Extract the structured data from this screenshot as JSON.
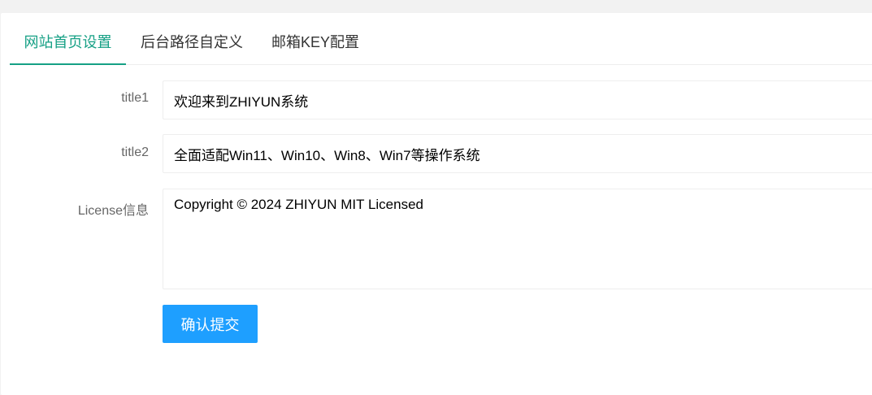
{
  "tabs": [
    {
      "label": "网站首页设置",
      "active": true
    },
    {
      "label": "后台路径自定义",
      "active": false
    },
    {
      "label": "邮箱KEY配置",
      "active": false
    }
  ],
  "form": {
    "title1": {
      "label": "title1",
      "value": "欢迎来到ZHIYUN系统"
    },
    "title2": {
      "label": "title2",
      "value": "全面适配Win11、Win10、Win8、Win7等操作系统"
    },
    "license": {
      "label": "License信息",
      "value": "Copyright © 2024 ZHIYUN MIT Licensed"
    },
    "submit_label": "确认提交"
  },
  "colors": {
    "accent": "#16a085",
    "button": "#1e9fff",
    "border": "#eeeeee",
    "background": "#f2f2f2"
  }
}
